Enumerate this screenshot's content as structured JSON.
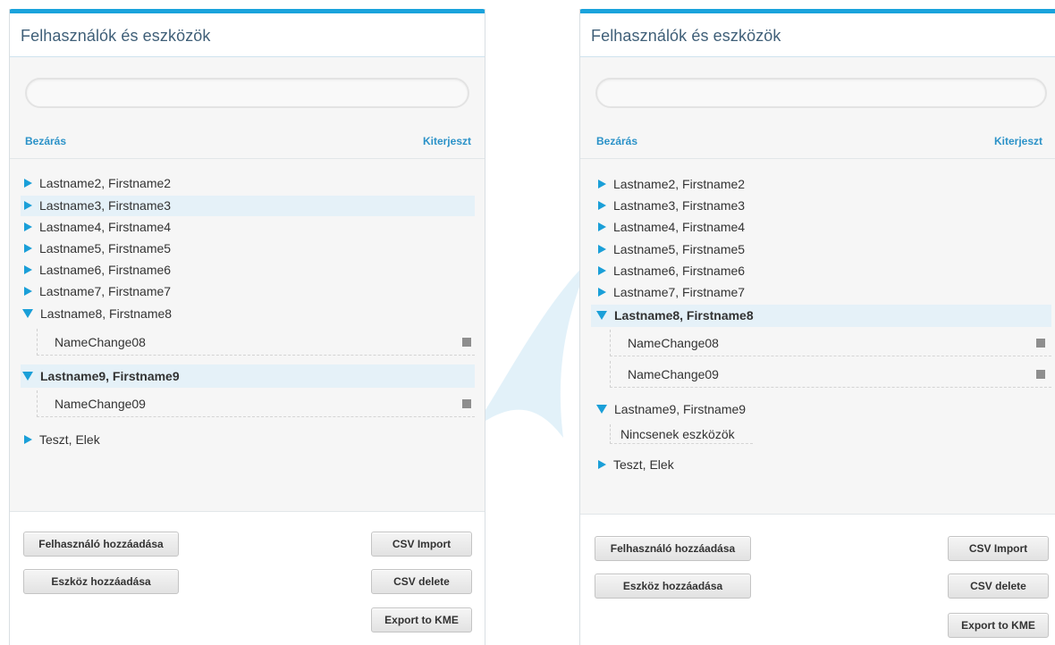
{
  "colors": {
    "accent": "#1aa3dc",
    "link": "#2b92c8",
    "highlight": "#e5f1f8",
    "triangle": "#1a9fd8"
  },
  "panels": [
    {
      "title": "Felhasználók és eszközök",
      "search": {
        "placeholder": "",
        "value": ""
      },
      "collapse_label": "Bezárás",
      "expand_label": "Kiterjeszt",
      "tree": [
        {
          "label": "Lastname2, Firstname2",
          "expanded": false
        },
        {
          "label": "Lastname3, Firstname3",
          "expanded": false,
          "highlighted": true
        },
        {
          "label": "Lastname4, Firstname4",
          "expanded": false
        },
        {
          "label": "Lastname5, Firstname5",
          "expanded": false
        },
        {
          "label": "Lastname6, Firstname6",
          "expanded": false
        },
        {
          "label": "Lastname7, Firstname7",
          "expanded": false
        },
        {
          "label": "Lastname8, Firstname8",
          "expanded": true,
          "devices": [
            "NameChange08"
          ]
        },
        {
          "label": "Lastname9, Firstname9",
          "expanded": true,
          "selected": true,
          "devices": [
            "NameChange09"
          ]
        },
        {
          "label": "Teszt, Elek",
          "expanded": false
        }
      ],
      "buttons": {
        "add_user": "Felhasználó hozzáadása",
        "add_device": "Eszköz hozzáadása",
        "csv_import": "CSV Import",
        "csv_delete": "CSV delete",
        "export_kme": "Export to KME"
      }
    },
    {
      "title": "Felhasználók és eszközök",
      "search": {
        "placeholder": "",
        "value": ""
      },
      "collapse_label": "Bezárás",
      "expand_label": "Kiterjeszt",
      "tree": [
        {
          "label": "Lastname2, Firstname2",
          "expanded": false
        },
        {
          "label": "Lastname3, Firstname3",
          "expanded": false
        },
        {
          "label": "Lastname4, Firstname4",
          "expanded": false
        },
        {
          "label": "Lastname5, Firstname5",
          "expanded": false
        },
        {
          "label": "Lastname6, Firstname6",
          "expanded": false
        },
        {
          "label": "Lastname7, Firstname7",
          "expanded": false
        },
        {
          "label": "Lastname8, Firstname8",
          "expanded": true,
          "selected": true,
          "devices": [
            "NameChange08",
            "NameChange09"
          ]
        },
        {
          "label": "Lastname9, Firstname9",
          "expanded": true,
          "devices": [],
          "empty_text": "Nincsenek eszközök"
        },
        {
          "label": "Teszt, Elek",
          "expanded": false
        }
      ],
      "buttons": {
        "add_user": "Felhasználó hozzáadása",
        "add_device": "Eszköz hozzáadása",
        "csv_import": "CSV Import",
        "csv_delete": "CSV delete",
        "export_kme": "Export to KME"
      }
    }
  ]
}
